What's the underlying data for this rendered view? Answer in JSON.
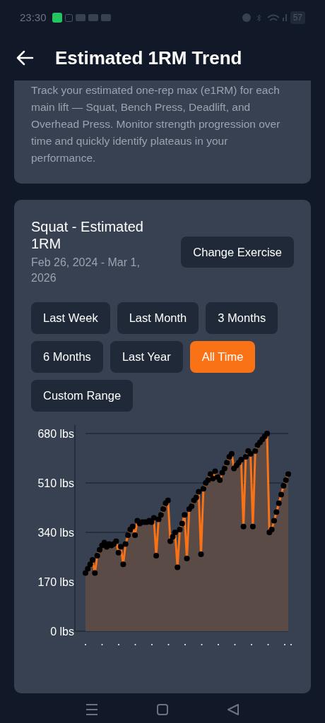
{
  "status_bar": {
    "time": "23:30",
    "battery": "57"
  },
  "header": {
    "title": "Estimated 1RM Trend"
  },
  "description": "Track your estimated one-rep max (e1RM) for each main lift — Squat, Bench Press, Deadlift, and Overhead Press. Monitor strength progression over time and quickly identify plateaus in your performance.",
  "card": {
    "title": "Squat - Estimated 1RM",
    "date_range": "Feb 26, 2024 - Mar 1, 2026",
    "change_button": "Change Exercise",
    "ranges": [
      {
        "label": "Last Week",
        "selected": false
      },
      {
        "label": "Last Month",
        "selected": false
      },
      {
        "label": "3 Months",
        "selected": false
      },
      {
        "label": "6 Months",
        "selected": false
      },
      {
        "label": "Last Year",
        "selected": false
      },
      {
        "label": "All Time",
        "selected": true
      },
      {
        "label": "Custom Range",
        "selected": false
      }
    ],
    "chart_data": {
      "type": "area",
      "ylim": [
        0,
        680
      ],
      "yticks": [
        {
          "value": 0,
          "label": "0 lbs"
        },
        {
          "value": 170,
          "label": "170 lbs"
        },
        {
          "value": 340,
          "label": "340 lbs"
        },
        {
          "value": 510,
          "label": "510 lbs"
        },
        {
          "value": 680,
          "label": "680 lbs"
        }
      ],
      "series": [
        {
          "color": "#f97316",
          "values": [
            200,
            215,
            230,
            245,
            200,
            260,
            280,
            295,
            305,
            290,
            300,
            295,
            300,
            310,
            270,
            290,
            230,
            300,
            330,
            350,
            360,
            330,
            380,
            370,
            375,
            375,
            375,
            380,
            375,
            390,
            260,
            385,
            400,
            420,
            440,
            450,
            310,
            325,
            340,
            220,
            350,
            370,
            400,
            250,
            420,
            430,
            450,
            460,
            480,
            265,
            490,
            510,
            520,
            540,
            525,
            550,
            530,
            520,
            545,
            560,
            580,
            600,
            610,
            560,
            570,
            580,
            590,
            360,
            600,
            620,
            610,
            360,
            620,
            640,
            650,
            660,
            670,
            680,
            340,
            350,
            380,
            410,
            440,
            470,
            500,
            520,
            540
          ]
        }
      ]
    }
  }
}
